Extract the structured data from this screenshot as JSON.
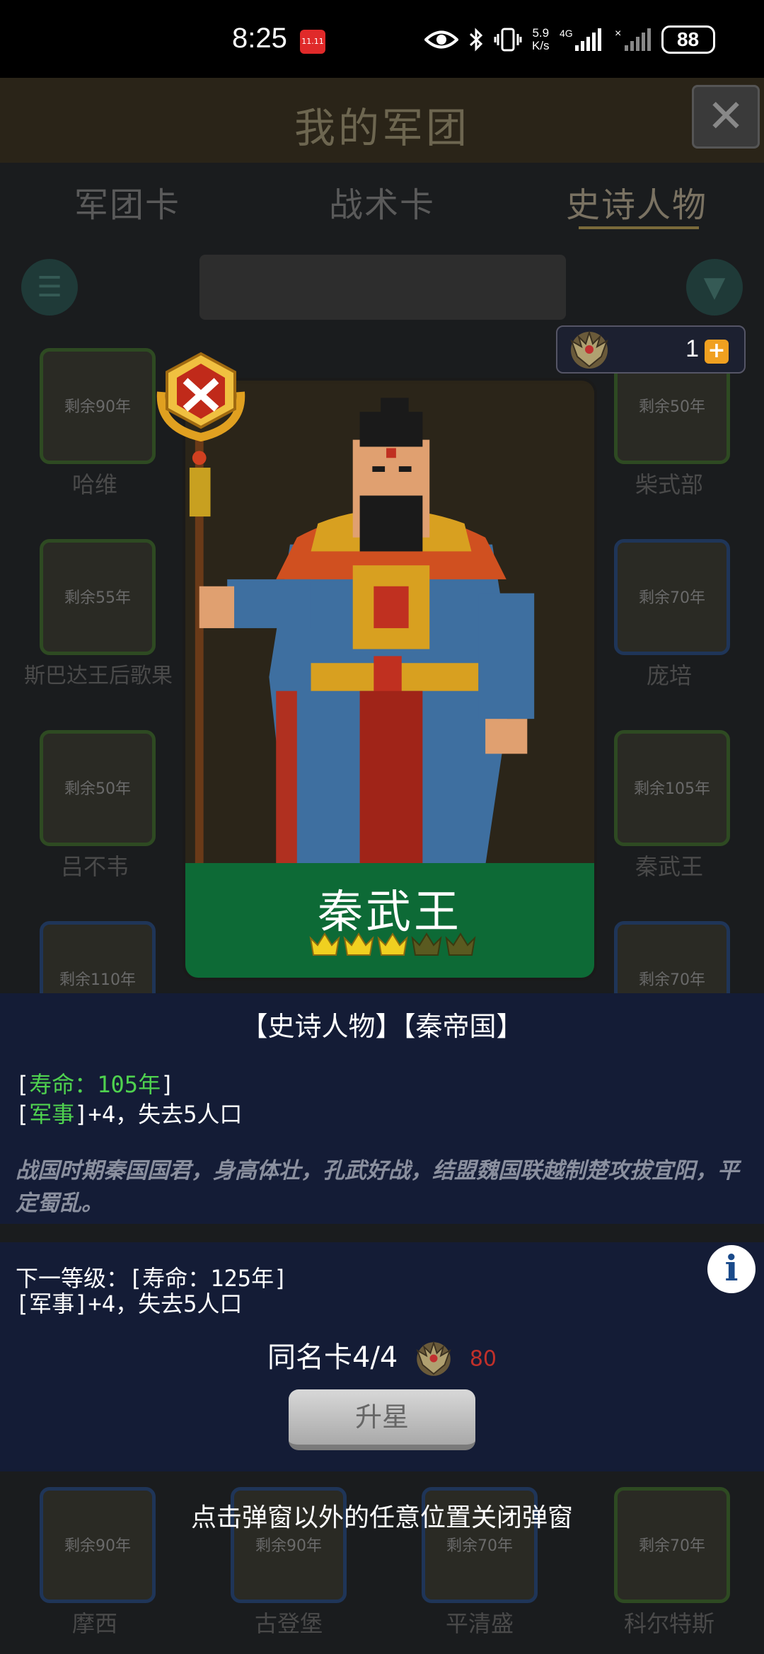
{
  "status_bar": {
    "time": "8:25",
    "badge": "11.11",
    "net_speed": "5.9",
    "net_unit": "K/s",
    "net_type": "4G",
    "battery": "88"
  },
  "background": {
    "title": "我的军团",
    "tabs": [
      {
        "label": "军团卡"
      },
      {
        "label": "战术卡"
      },
      {
        "label": "史诗人物"
      }
    ],
    "cards": [
      {
        "remain": "剩余90年",
        "name": "哈维"
      },
      {
        "remain": "剩余50年",
        "name": "柴式部"
      },
      {
        "remain": "剩余55年",
        "name": "斯巴达王后歌果"
      },
      {
        "remain": "剩余70年",
        "name": "庞培"
      },
      {
        "remain": "剩余50年",
        "name": "吕不韦"
      },
      {
        "remain": "剩余105年",
        "name": "秦武王"
      },
      {
        "remain": "剩余110年",
        "name": ""
      },
      {
        "remain": "剩余70年",
        "name": ""
      },
      {
        "remain": "剩余90年",
        "name": "摩西"
      },
      {
        "remain": "剩余90年",
        "name": "古登堡"
      },
      {
        "remain": "剩余70年",
        "name": "平清盛"
      },
      {
        "remain": "剩余70年",
        "name": "科尔特斯"
      }
    ]
  },
  "currency": {
    "count": "1",
    "plus": "+"
  },
  "hero": {
    "name": "秦武王",
    "crowns_filled": 3,
    "crowns_total": 5
  },
  "details": {
    "tags": "【史诗人物】【秦帝国】",
    "lifespan_label": "寿命：105年",
    "military_label": "军事",
    "military_effect": "+4，失去5人口",
    "description": "战国时期秦国国君，身高体壮，孔武好战，结盟魏国联越制楚攻拔宜阳，平定蜀乱。"
  },
  "next_level": {
    "line1": "下一等级：[寿命：125年]",
    "line2": "[军事]+4，失去5人口"
  },
  "upgrade": {
    "dup_label": "同名卡4/4",
    "cost": "80",
    "button": "升星"
  },
  "hint": "点击弹窗以外的任意位置关闭弹窗",
  "colors": {
    "panel": "#141c36",
    "accent_green": "#4fd24f",
    "name_bar": "#0d6a36"
  }
}
